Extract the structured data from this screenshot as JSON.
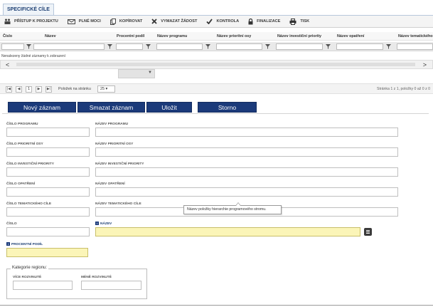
{
  "page": {
    "title": "SPECIFICKÉ CÍLE"
  },
  "toolbar": {
    "items": [
      {
        "label": "PŘÍSTUP K PROJEKTU",
        "icon": "people-icon"
      },
      {
        "label": "PLNÉ MOCI",
        "icon": "envelope-icon"
      },
      {
        "label": "KOPÍROVAT",
        "icon": "copy-icon"
      },
      {
        "label": "VYMAZAT ŽÁDOST",
        "icon": "delete-x-icon"
      },
      {
        "label": "KONTROLA",
        "icon": "checkmark-icon"
      },
      {
        "label": "FINALIZACE",
        "icon": "lock-icon"
      },
      {
        "label": "TISK",
        "icon": "printer-icon"
      }
    ]
  },
  "grid": {
    "columns": [
      "Číslo",
      "Název",
      "Procentní podíl",
      "Název programu",
      "Název prioritní osy",
      "Název investiční priority",
      "Název opatření",
      "Název tematického"
    ],
    "no_results": "Nenalezeny žádné záznamy k zobrazení"
  },
  "pager": {
    "current_page": "1",
    "page_size_label": "Položek na stránku",
    "page_size": "25",
    "info": "Stránka 1 z 1, položky 0 až 0 z 0"
  },
  "actions": {
    "new": "Nový záznam",
    "delete": "Smazat záznam",
    "save": "Uložit",
    "cancel": "Storno"
  },
  "form": {
    "cislo_programu": "ČÍSLO PROGRAMU",
    "nazev_programu": "NÁZEV PROGRAMU",
    "cislo_prioritni_osy": "ČÍSLO PRIORITNÍ OSY",
    "nazev_prioritni_osy": "NÁZEV PRIORITNÍ OSY",
    "cislo_investicni_priority": "ČÍSLO INVESTIČNÍ PRIORITY",
    "nazev_investicni_priority": "NÁZEV INVESTIČNÍ PRIORITY",
    "cislo_opatreni": "ČÍSLO OPATŘENÍ",
    "nazev_opatreni": "NÁZEV OPATŘENÍ",
    "cislo_tematickeho_cile": "ČÍSLO TEMATICKÉHO CÍLE",
    "nazev_tematickeho_cile": "NÁZEV TEMATICKÉHO CÍLE",
    "cislo": "ČÍSLO",
    "nazev": "NÁZEV",
    "procentni_podil": "PROCENTNÍ PODÍL",
    "tooltip": "Název položky hierarchie programového stromu.",
    "region_legend": "Kategorie regionu:",
    "vice_rozvinute": "VÍCE ROZVINUTÉ",
    "mene_rozvinute": "MÉNĚ ROZVINUTÉ"
  },
  "colors": {
    "primary": "#1b3a7a",
    "required_field": "#fbf5b8"
  }
}
